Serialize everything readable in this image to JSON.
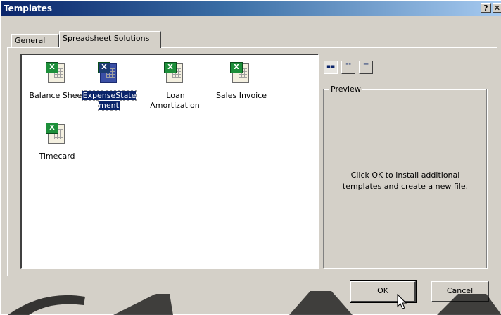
{
  "window": {
    "title": "Templates",
    "help_label": "?",
    "close_label": "✕"
  },
  "tabs": [
    {
      "label": "General"
    },
    {
      "label": "Spreadsheet Solutions"
    }
  ],
  "templates": [
    {
      "label": "Balance Sheet",
      "icon": "excel-template-icon"
    },
    {
      "label": "ExpenseState\nment",
      "icon": "excel-template-icon"
    },
    {
      "label": "Loan\nAmortization",
      "icon": "excel-template-icon"
    },
    {
      "label": "Sales Invoice",
      "icon": "excel-template-icon"
    },
    {
      "label": "Timecard",
      "icon": "excel-template-icon"
    }
  ],
  "preview": {
    "legend": "Preview",
    "message": "Click OK to install additional\ntemplates and create a new file."
  },
  "buttons": {
    "ok": "OK",
    "cancel": "Cancel"
  },
  "colors": {
    "titlebar_start": "#0a246a",
    "face": "#d4d0c8",
    "selection": "#0a246a"
  }
}
